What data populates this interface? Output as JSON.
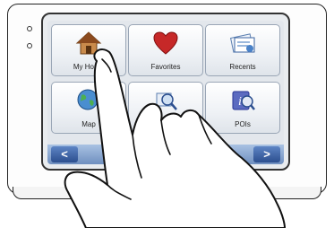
{
  "screen": {
    "tiles": [
      {
        "label": "My Home",
        "icon": "home-icon"
      },
      {
        "label": "Favorites",
        "icon": "heart-icon"
      },
      {
        "label": "Recents",
        "icon": "recents-icon"
      },
      {
        "label": "Map",
        "icon": "map-icon"
      },
      {
        "label": "",
        "icon": "search-icon"
      },
      {
        "label": "POIs",
        "icon": "poi-icon"
      }
    ],
    "nav": {
      "prev": "<",
      "next": ">"
    }
  },
  "colors": {
    "heart": "#c62828",
    "navbar": "#6f8fbf",
    "bezel": "#333333"
  }
}
